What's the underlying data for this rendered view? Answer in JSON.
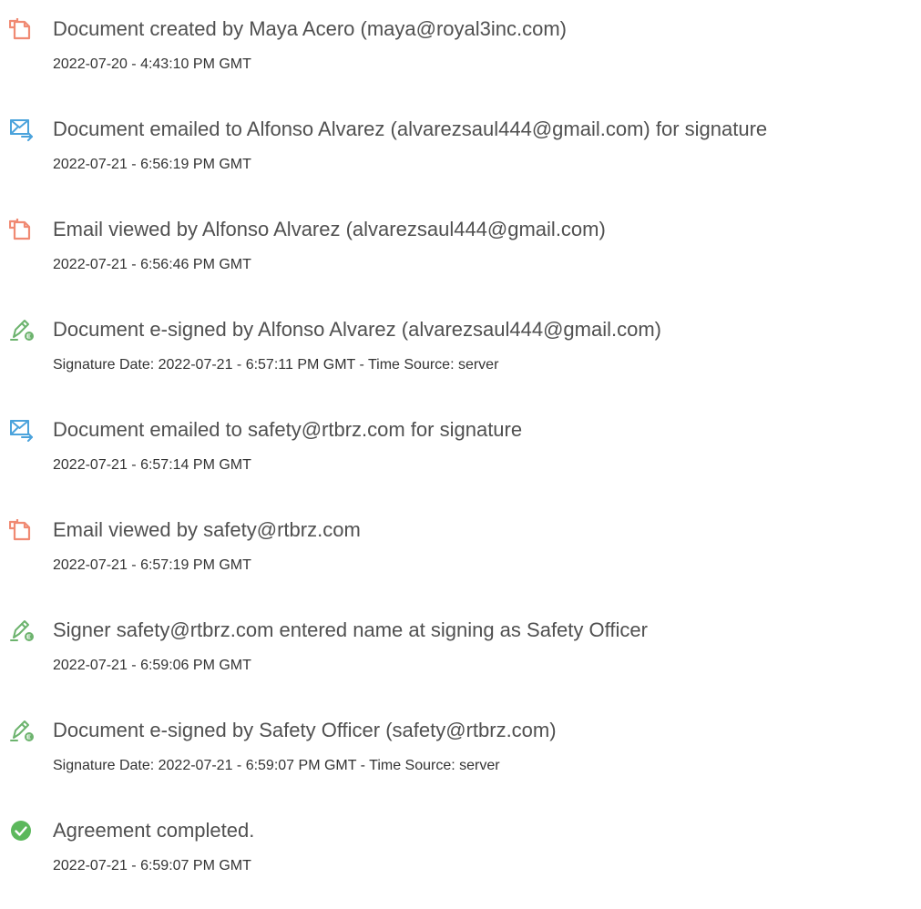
{
  "colors": {
    "document_icon": "#f08a73",
    "email_icon": "#4ba3dc",
    "signature_icon": "#6cb36d",
    "complete_icon": "#5cb85c",
    "title_text": "#505050",
    "detail_text": "#333333"
  },
  "events": [
    {
      "icon": "document-icon",
      "title": "Document created by Maya Acero (maya@royal3inc.com)",
      "detail": "2022-07-20 - 4:43:10 PM GMT"
    },
    {
      "icon": "email-sent-icon",
      "title": "Document emailed to Alfonso Alvarez (alvarezsaul444@gmail.com) for signature",
      "detail": "2022-07-21 - 6:56:19 PM GMT"
    },
    {
      "icon": "document-icon",
      "title": "Email viewed by Alfonso Alvarez (alvarezsaul444@gmail.com)",
      "detail": "2022-07-21 - 6:56:46 PM GMT"
    },
    {
      "icon": "e-sign-pen-icon",
      "title": "Document e-signed by Alfonso Alvarez (alvarezsaul444@gmail.com)",
      "detail": "Signature Date: 2022-07-21 - 6:57:11 PM GMT - Time Source: server"
    },
    {
      "icon": "email-sent-icon",
      "title": "Document emailed to safety@rtbrz.com for signature",
      "detail": "2022-07-21 - 6:57:14 PM GMT"
    },
    {
      "icon": "document-icon",
      "title": "Email viewed by safety@rtbrz.com",
      "detail": "2022-07-21 - 6:57:19 PM GMT"
    },
    {
      "icon": "e-sign-pen-icon",
      "title": "Signer safety@rtbrz.com entered name at signing as Safety Officer",
      "detail": "2022-07-21 - 6:59:06 PM GMT"
    },
    {
      "icon": "e-sign-pen-icon",
      "title": "Document e-signed by Safety Officer (safety@rtbrz.com)",
      "detail": "Signature Date: 2022-07-21 - 6:59:07 PM GMT - Time Source: server"
    },
    {
      "icon": "check-circle-icon",
      "title": "Agreement completed.",
      "detail": "2022-07-21 - 6:59:07 PM GMT"
    }
  ]
}
